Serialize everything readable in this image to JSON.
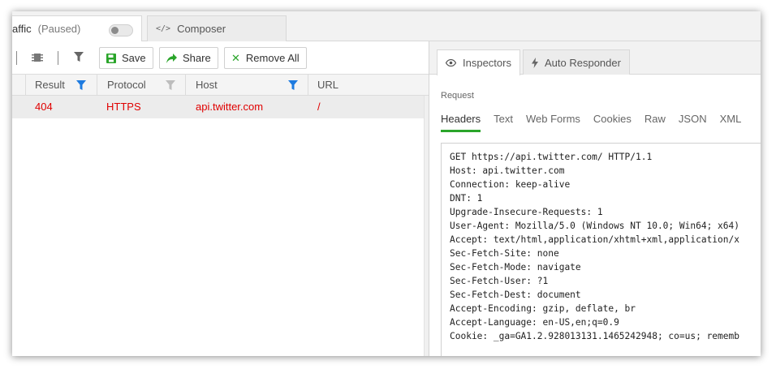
{
  "tabs": {
    "traffic_label": "affic",
    "traffic_status": "(Paused)",
    "composer_label": "Composer"
  },
  "toolbar": {
    "save_label": "Save",
    "share_label": "Share",
    "remove_all_label": "Remove All"
  },
  "grid": {
    "columns": [
      "Result",
      "Protocol",
      "Host",
      "URL"
    ],
    "rows": [
      {
        "result": "404",
        "protocol": "HTTPS",
        "host": "api.twitter.com",
        "url": "/"
      }
    ]
  },
  "inspector": {
    "tabs": [
      "Inspectors",
      "Auto Responder"
    ],
    "section_label": "Request",
    "subtabs": [
      "Headers",
      "Text",
      "Web Forms",
      "Cookies",
      "Raw",
      "JSON",
      "XML"
    ],
    "raw_lines": [
      "GET https://api.twitter.com/ HTTP/1.1",
      "Host: api.twitter.com",
      "Connection: keep-alive",
      "DNT: 1",
      "Upgrade-Insecure-Requests: 1",
      "User-Agent: Mozilla/5.0 (Windows NT 10.0; Win64; x64)",
      "Accept: text/html,application/xhtml+xml,application/x",
      "Sec-Fetch-Site: none",
      "Sec-Fetch-Mode: navigate",
      "Sec-Fetch-User: ?1",
      "Sec-Fetch-Dest: document",
      "Accept-Encoding: gzip, deflate, br",
      "Accept-Language: en-US,en;q=0.9",
      "Cookie: _ga=GA1.2.928013131.1465242948; co=us; rememb"
    ]
  },
  "colors": {
    "error_text": "#e00000",
    "active_subtab": "#2aa52a",
    "filter_active": "#1e7be0",
    "filter_inactive": "#bdbdbd",
    "save_icon": "#2aa52a",
    "share_icon": "#2aa52a",
    "remove_icon": "#2aa52a"
  }
}
